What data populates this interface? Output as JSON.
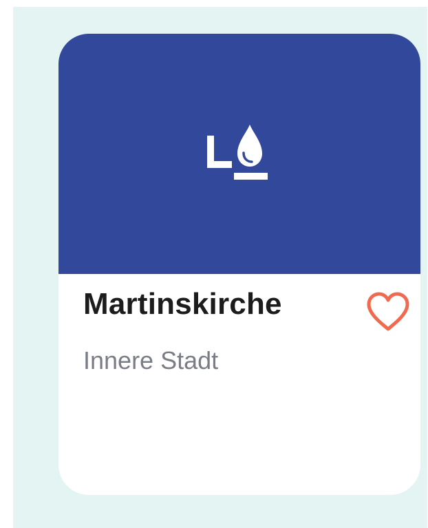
{
  "card": {
    "title": "Martinskirche",
    "subtitle": "Innere Stadt",
    "image_icon": "drop-with-level-icon",
    "favorite_icon": "heart-outline-icon"
  },
  "colors": {
    "background": "#e3f4f3",
    "card_image": "#32489a",
    "heart": "#ef6a4f",
    "title": "#1c1c1c",
    "subtitle": "#7a7c86"
  }
}
